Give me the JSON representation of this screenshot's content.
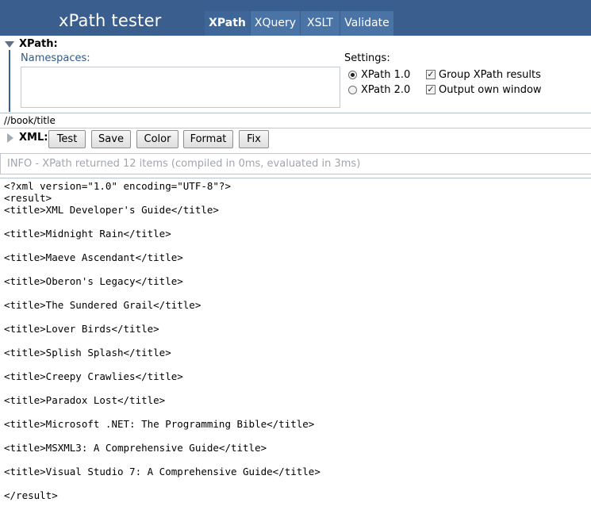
{
  "app": {
    "title": "xPath tester"
  },
  "tabs": [
    {
      "label": "XPath",
      "active": true
    },
    {
      "label": "XQuery",
      "active": false
    },
    {
      "label": "XSLT",
      "active": false
    },
    {
      "label": "Validate",
      "active": false
    }
  ],
  "xpath_panel": {
    "label": "XPath:",
    "namespaces_label": "Namespaces:",
    "namespaces_value": "",
    "settings_label": "Settings:",
    "version_options": [
      {
        "label": "XPath 1.0",
        "selected": true
      },
      {
        "label": "XPath 2.0",
        "selected": false
      }
    ],
    "checkboxes": [
      {
        "label": "Group XPath results",
        "checked": true
      },
      {
        "label": "Output own window",
        "checked": true
      }
    ]
  },
  "expression": "//book/title",
  "xml_toolbar": {
    "label": "XML:",
    "buttons": [
      "Test",
      "Save",
      "Color",
      "Format",
      "Fix"
    ]
  },
  "info": "INFO - XPath returned 12 items (compiled in 0ms, evaluated in 3ms)",
  "result_lines": [
    "<?xml version=\"1.0\" encoding=\"UTF-8\"?>",
    "<result>",
    "<title>XML Developer's Guide</title>",
    "",
    "<title>Midnight Rain</title>",
    "",
    "<title>Maeve Ascendant</title>",
    "",
    "<title>Oberon's Legacy</title>",
    "",
    "<title>The Sundered Grail</title>",
    "",
    "<title>Lover Birds</title>",
    "",
    "<title>Splish Splash</title>",
    "",
    "<title>Creepy Crawlies</title>",
    "",
    "<title>Paradox Lost</title>",
    "",
    "<title>Microsoft .NET: The Programming Bible</title>",
    "",
    "<title>MSXML3: A Comprehensive Guide</title>",
    "",
    "<title>Visual Studio 7: A Comprehensive Guide</title>",
    "",
    "</result>"
  ],
  "colors": {
    "header": "#3a5f8e",
    "tab": "#4a73a6",
    "label_blue": "#2f5a88",
    "info_text": "#a0a6ad"
  }
}
